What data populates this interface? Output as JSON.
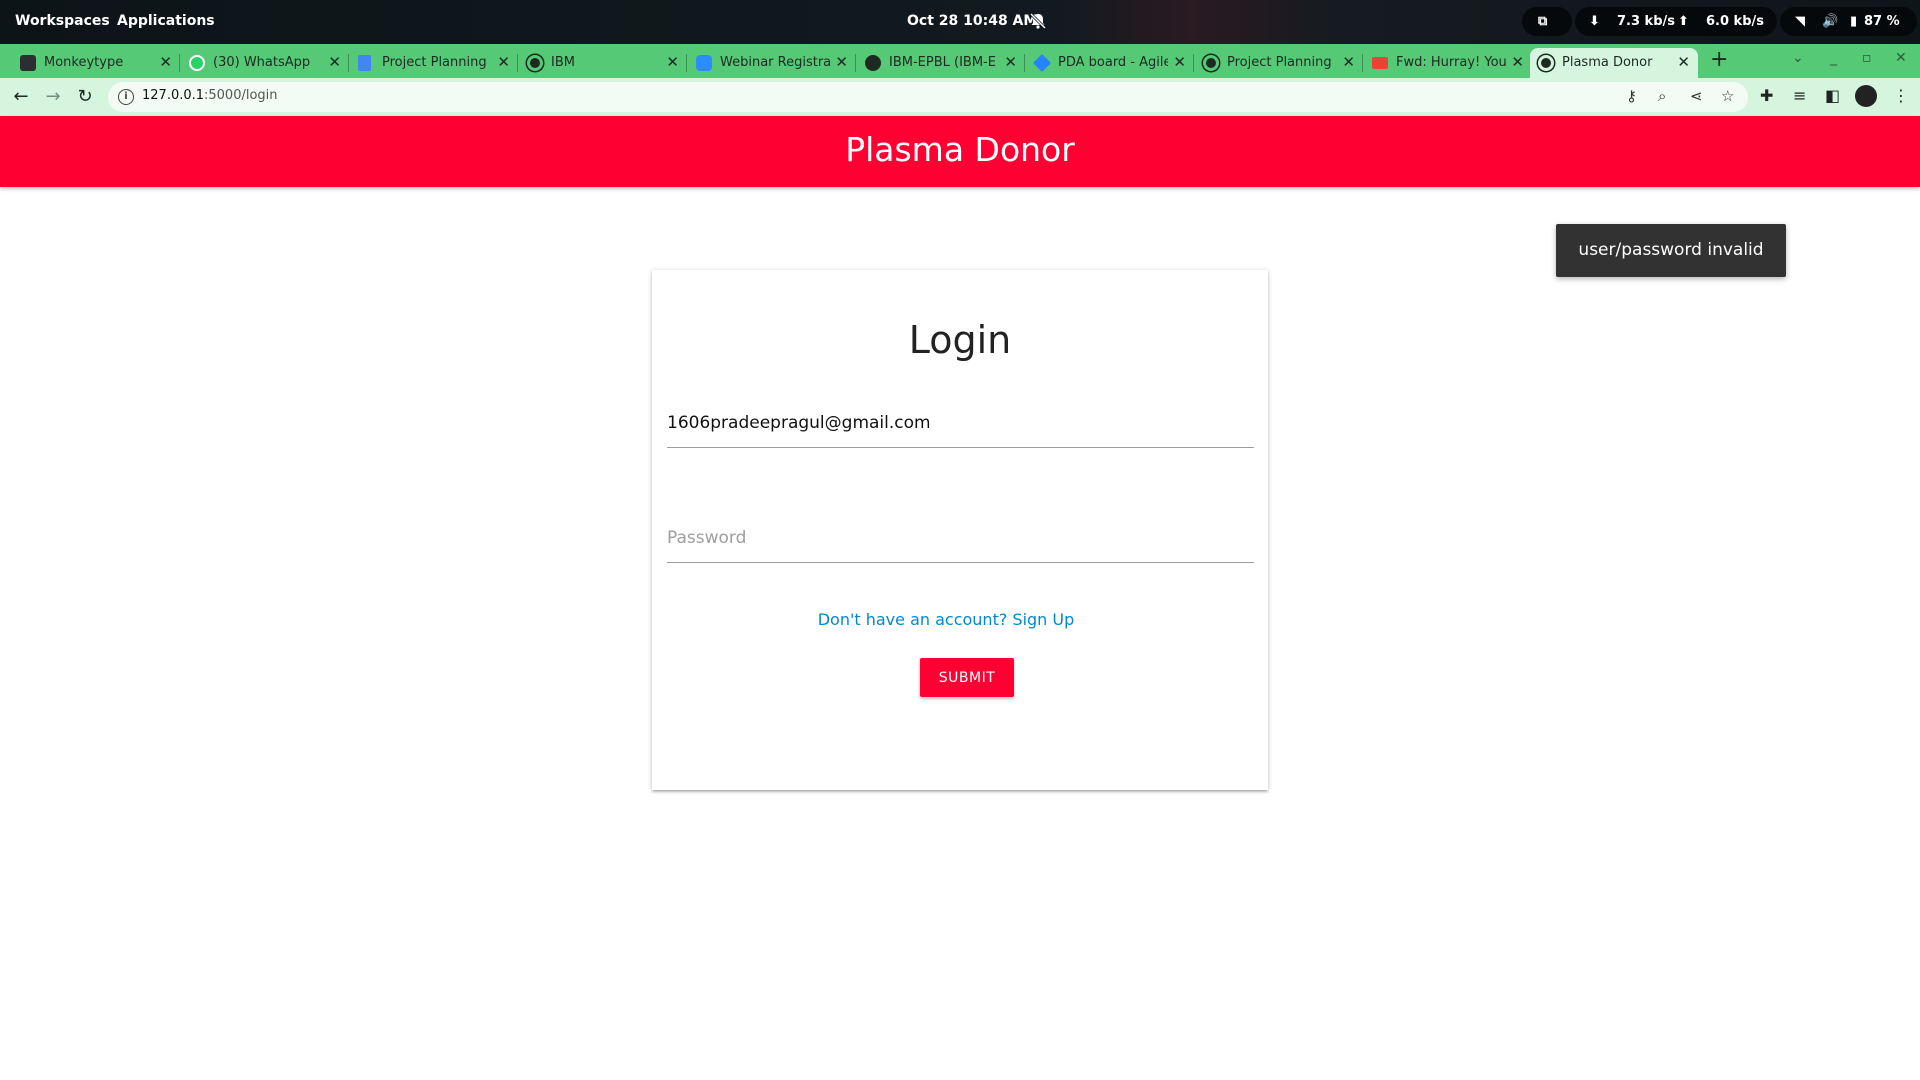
{
  "os": {
    "workspaces": "Workspaces",
    "applications": "Applications",
    "clock": "Oct 28  10:48 AM",
    "download_speed": "7.3 kb/s",
    "upload_speed": "6.0 kb/s",
    "battery": "87 %"
  },
  "browser": {
    "tabs": [
      {
        "title": "Monkeytype",
        "icon": "monkeytype-icon"
      },
      {
        "title": "(30) WhatsApp",
        "icon": "whatsapp-icon"
      },
      {
        "title": "Project Planning",
        "icon": "docs-icon"
      },
      {
        "title": "IBM",
        "icon": "globe-icon"
      },
      {
        "title": "Webinar Registra",
        "icon": "zoom-icon"
      },
      {
        "title": "IBM-EPBL (IBM-E",
        "icon": "github-icon"
      },
      {
        "title": "PDA board - Agile",
        "icon": "jira-icon"
      },
      {
        "title": "Project Planning",
        "icon": "globe-icon"
      },
      {
        "title": "Fwd: Hurray! Your",
        "icon": "gmail-icon"
      },
      {
        "title": "Plasma Donor",
        "icon": "globe-icon",
        "active": true
      }
    ],
    "url_host": "127.0.0.1",
    "url_path": ":5000/login",
    "theme_color": "#55c975"
  },
  "page": {
    "site_title": "Plasma Donor",
    "brand_color": "#ff0033",
    "toast": "user/password invalid",
    "login_title": "Login",
    "email_value": "1606pradeepragul@gmail.com",
    "password_placeholder": "Password",
    "signup_link": "Don't have an account? Sign Up",
    "submit_label": "SUBMIT"
  }
}
